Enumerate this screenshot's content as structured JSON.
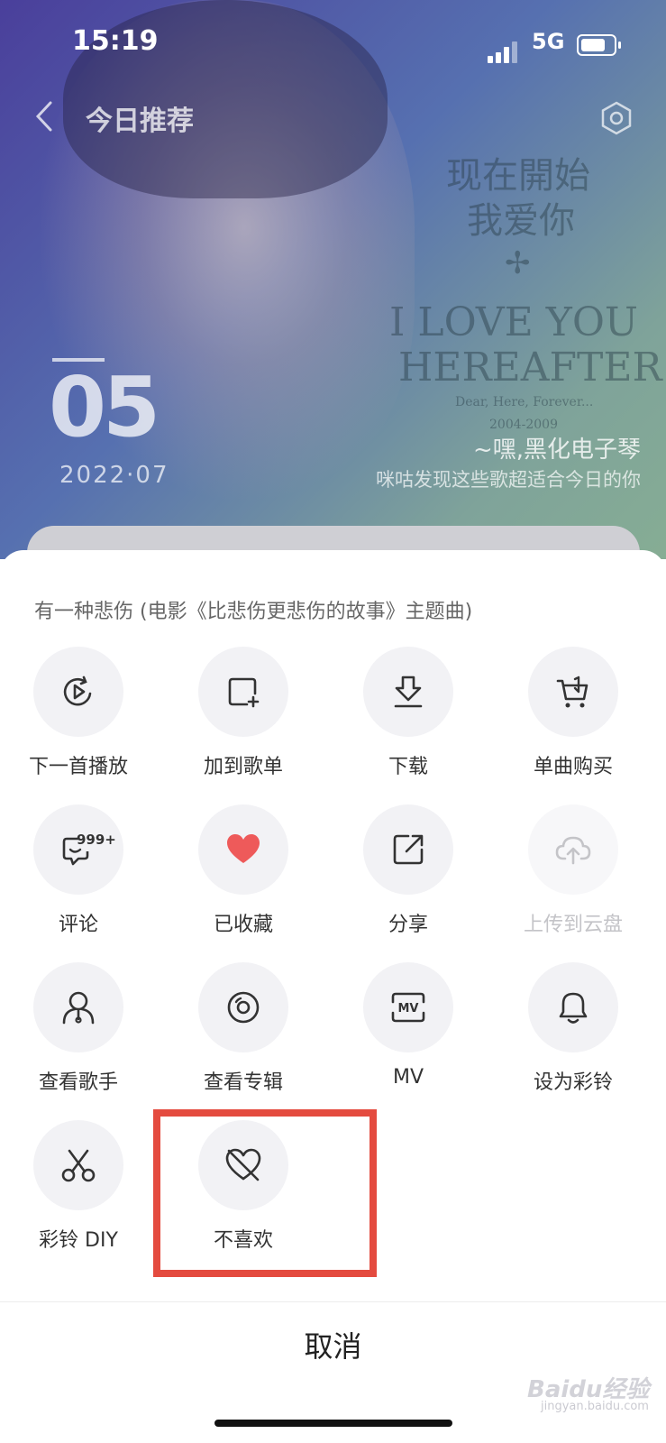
{
  "status_bar": {
    "time": "15:19",
    "network": "5G"
  },
  "header": {
    "title": "今日推荐"
  },
  "album_art": {
    "title_line1": "现在開始",
    "title_line2": "我爱你",
    "english_line1": "I LOVE YOU",
    "english_line2": "HEREAFTER",
    "tagline": "Dear, Here, Forever...",
    "years": "2004-2009"
  },
  "daily": {
    "day": "05",
    "date": "2022·07",
    "byline": "~嘿,黑化电子琴",
    "subtitle": "咪咕发现这些歌超适合今日的你"
  },
  "sheet": {
    "song_title": "有一种悲伤 (电影《比悲伤更悲伤的故事》主题曲)",
    "comment_badge": "999+",
    "actions": [
      {
        "label": "下一首播放",
        "icon": "play-next-icon",
        "enabled": true
      },
      {
        "label": "加到歌单",
        "icon": "add-to-playlist-icon",
        "enabled": true
      },
      {
        "label": "下载",
        "icon": "download-icon",
        "enabled": true
      },
      {
        "label": "单曲购买",
        "icon": "cart-icon",
        "enabled": true
      },
      {
        "label": "评论",
        "icon": "comment-icon",
        "enabled": true
      },
      {
        "label": "已收藏",
        "icon": "heart-filled-icon",
        "enabled": true
      },
      {
        "label": "分享",
        "icon": "share-icon",
        "enabled": true
      },
      {
        "label": "上传到云盘",
        "icon": "cloud-upload-icon",
        "enabled": false
      },
      {
        "label": "查看歌手",
        "icon": "singer-icon",
        "enabled": true
      },
      {
        "label": "查看专辑",
        "icon": "album-disc-icon",
        "enabled": true
      },
      {
        "label": "MV",
        "icon": "mv-icon",
        "enabled": true
      },
      {
        "label": "设为彩铃",
        "icon": "bell-icon",
        "enabled": true
      },
      {
        "label": "彩铃 DIY",
        "icon": "scissors-icon",
        "enabled": true
      },
      {
        "label": "不喜欢",
        "icon": "dislike-heart-icon",
        "enabled": true
      }
    ],
    "cancel": "取消"
  },
  "watermark": {
    "brand": "Baidu经验",
    "url": "jingyan.baidu.com"
  },
  "colors": {
    "highlight": "#e44b3f",
    "heart": "#ee5a5a"
  }
}
